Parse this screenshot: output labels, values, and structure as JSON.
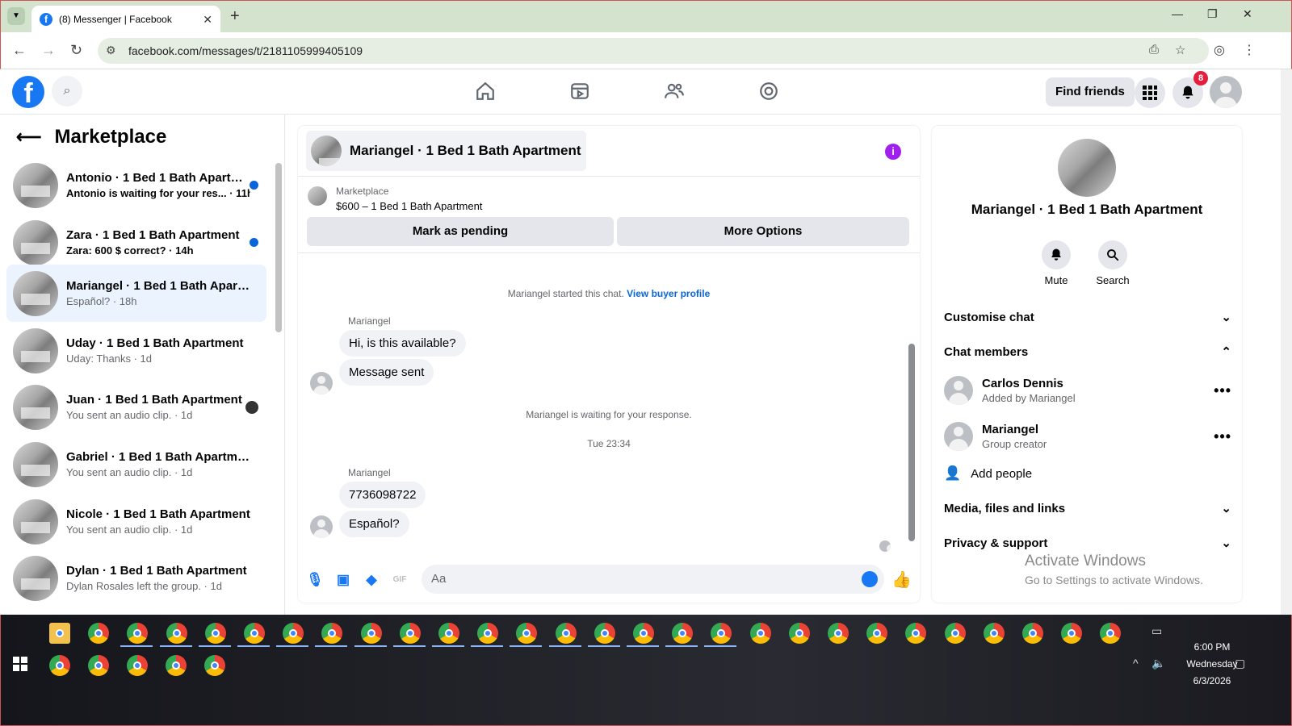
{
  "browser": {
    "tab_title": "(8) Messenger | Facebook",
    "url": "facebook.com/messages/t/2181105999405109"
  },
  "topbar": {
    "find_friends": "Find friends",
    "notification_count": "8"
  },
  "sidebar": {
    "title": "Marketplace",
    "conversations": [
      {
        "name": "Antonio · 1 Bed 1 Bath Apartm...",
        "preview": "Antonio is waiting for your res... · 11h",
        "unread": true
      },
      {
        "name": "Zara · 1 Bed 1 Bath Apartment",
        "preview": "Zara: 600 $ correct? · 14h",
        "unread": true
      },
      {
        "name": "Mariangel · 1 Bed 1 Bath Apartm...",
        "preview": "Español? · 18h",
        "active": true
      },
      {
        "name": "Uday · 1 Bed 1 Bath Apartment",
        "preview": "Uday: Thanks · 1d"
      },
      {
        "name": "Juan · 1 Bed 1 Bath Apartment",
        "preview": "You sent an audio clip. · 1d"
      },
      {
        "name": "Gabriel · 1 Bed 1 Bath Apartment",
        "preview": "You sent an audio clip. · 1d"
      },
      {
        "name": "Nicole · 1 Bed 1 Bath Apartment",
        "preview": "You sent an audio clip. · 1d"
      },
      {
        "name": "Dylan · 1 Bed 1 Bath Apartment",
        "preview": "Dylan Rosales left the group. · 1d"
      }
    ]
  },
  "chat": {
    "title": "Mariangel · 1 Bed 1 Bath Apartment",
    "marketplace_label": "Marketplace",
    "listing": "$600 – 1 Bed 1 Bath Apartment",
    "mark_pending": "Mark as pending",
    "more_options": "More Options",
    "started_text": "Mariangel started this chat.",
    "view_profile": "View buyer profile",
    "sender1": "Mariangel",
    "msg1": "Hi, is this available?",
    "msg2": "Message sent",
    "waiting": "Mariangel is waiting for your response.",
    "timestamp": "Tue 23:34",
    "sender2": "Mariangel",
    "msg3": "7736098722",
    "msg4": "Español?",
    "input_placeholder": "Aa"
  },
  "details": {
    "title": "Mariangel · 1 Bed 1 Bath Apartment",
    "mute": "Mute",
    "search": "Search",
    "customise": "Customise chat",
    "chat_members": "Chat members",
    "members": [
      {
        "name": "Carlos Dennis",
        "sub": "Added by Mariangel"
      },
      {
        "name": "Mariangel",
        "sub": "Group creator"
      }
    ],
    "add_people": "Add people",
    "media": "Media, files and links",
    "privacy": "Privacy & support"
  },
  "watermark": {
    "line1": "Activate Windows",
    "line2": "Go to Settings to activate Windows."
  },
  "taskbar": {
    "time": "6:00 PM",
    "day": "Wednesday",
    "date": "6/3/2026"
  }
}
